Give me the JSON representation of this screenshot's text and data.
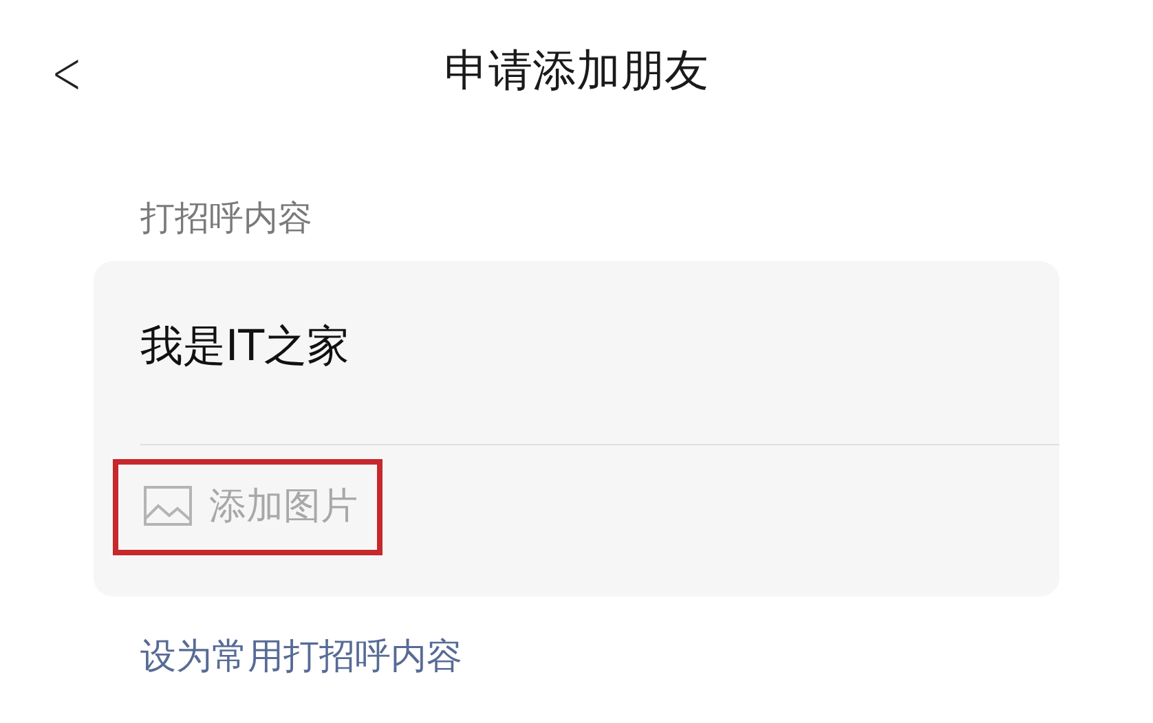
{
  "header": {
    "back": "<",
    "title": "申请添加朋友"
  },
  "greeting": {
    "label": "打招呼内容",
    "message": "我是IT之家",
    "add_image": {
      "label": "添加图片",
      "highlighted": true
    }
  },
  "set_default_link": "设为常用打招呼内容"
}
